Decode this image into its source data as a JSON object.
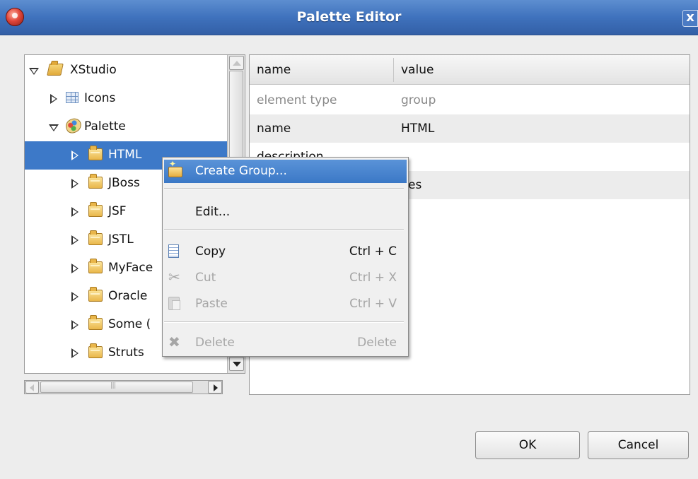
{
  "window": {
    "title": "Palette Editor",
    "close_label": "x"
  },
  "tree": {
    "items": [
      {
        "label": "XStudio",
        "icon": "folder-open-icon",
        "expanded": true
      },
      {
        "label": "Icons",
        "icon": "icons-grid-icon",
        "expanded": false
      },
      {
        "label": "Palette",
        "icon": "palette-icon",
        "expanded": true
      },
      {
        "label": "HTML",
        "icon": "folder-icon",
        "expanded": false,
        "selected": true
      },
      {
        "label": "JBoss",
        "icon": "folder-icon",
        "expanded": false
      },
      {
        "label": "JSF",
        "icon": "folder-icon",
        "expanded": false
      },
      {
        "label": "JSTL",
        "icon": "folder-icon",
        "expanded": false
      },
      {
        "label": "MyFace",
        "icon": "folder-icon",
        "expanded": false
      },
      {
        "label": "Oracle",
        "icon": "folder-icon",
        "expanded": false
      },
      {
        "label": "Some (",
        "icon": "folder-icon",
        "expanded": false
      },
      {
        "label": "Struts",
        "icon": "folder-icon",
        "expanded": false
      }
    ]
  },
  "properties": {
    "columns": [
      "name",
      "value"
    ],
    "rows": [
      {
        "name": "element type",
        "value": "group",
        "muted": true
      },
      {
        "name": "name",
        "value": "HTML"
      },
      {
        "name": "description",
        "value": ""
      },
      {
        "name": "",
        "value": "yes"
      }
    ]
  },
  "context_menu": {
    "items": [
      {
        "label": "Create Group...",
        "shortcut": "",
        "icon": "create-group-icon",
        "enabled": true,
        "highlighted": true
      },
      {
        "label": "Edit...",
        "shortcut": "",
        "icon": "",
        "enabled": true
      },
      {
        "label": "Copy",
        "shortcut": "Ctrl + C",
        "icon": "copy-icon",
        "enabled": true
      },
      {
        "label": "Cut",
        "shortcut": "Ctrl + X",
        "icon": "cut-icon",
        "enabled": false
      },
      {
        "label": "Paste",
        "shortcut": "Ctrl + V",
        "icon": "paste-icon",
        "enabled": false
      },
      {
        "label": "Delete",
        "shortcut": "Delete",
        "icon": "delete-icon",
        "enabled": false
      }
    ]
  },
  "buttons": {
    "ok": "OK",
    "cancel": "Cancel"
  },
  "colors": {
    "titlebar": "#3f72bd",
    "selection": "#3d79c8",
    "background": "#ededed"
  }
}
